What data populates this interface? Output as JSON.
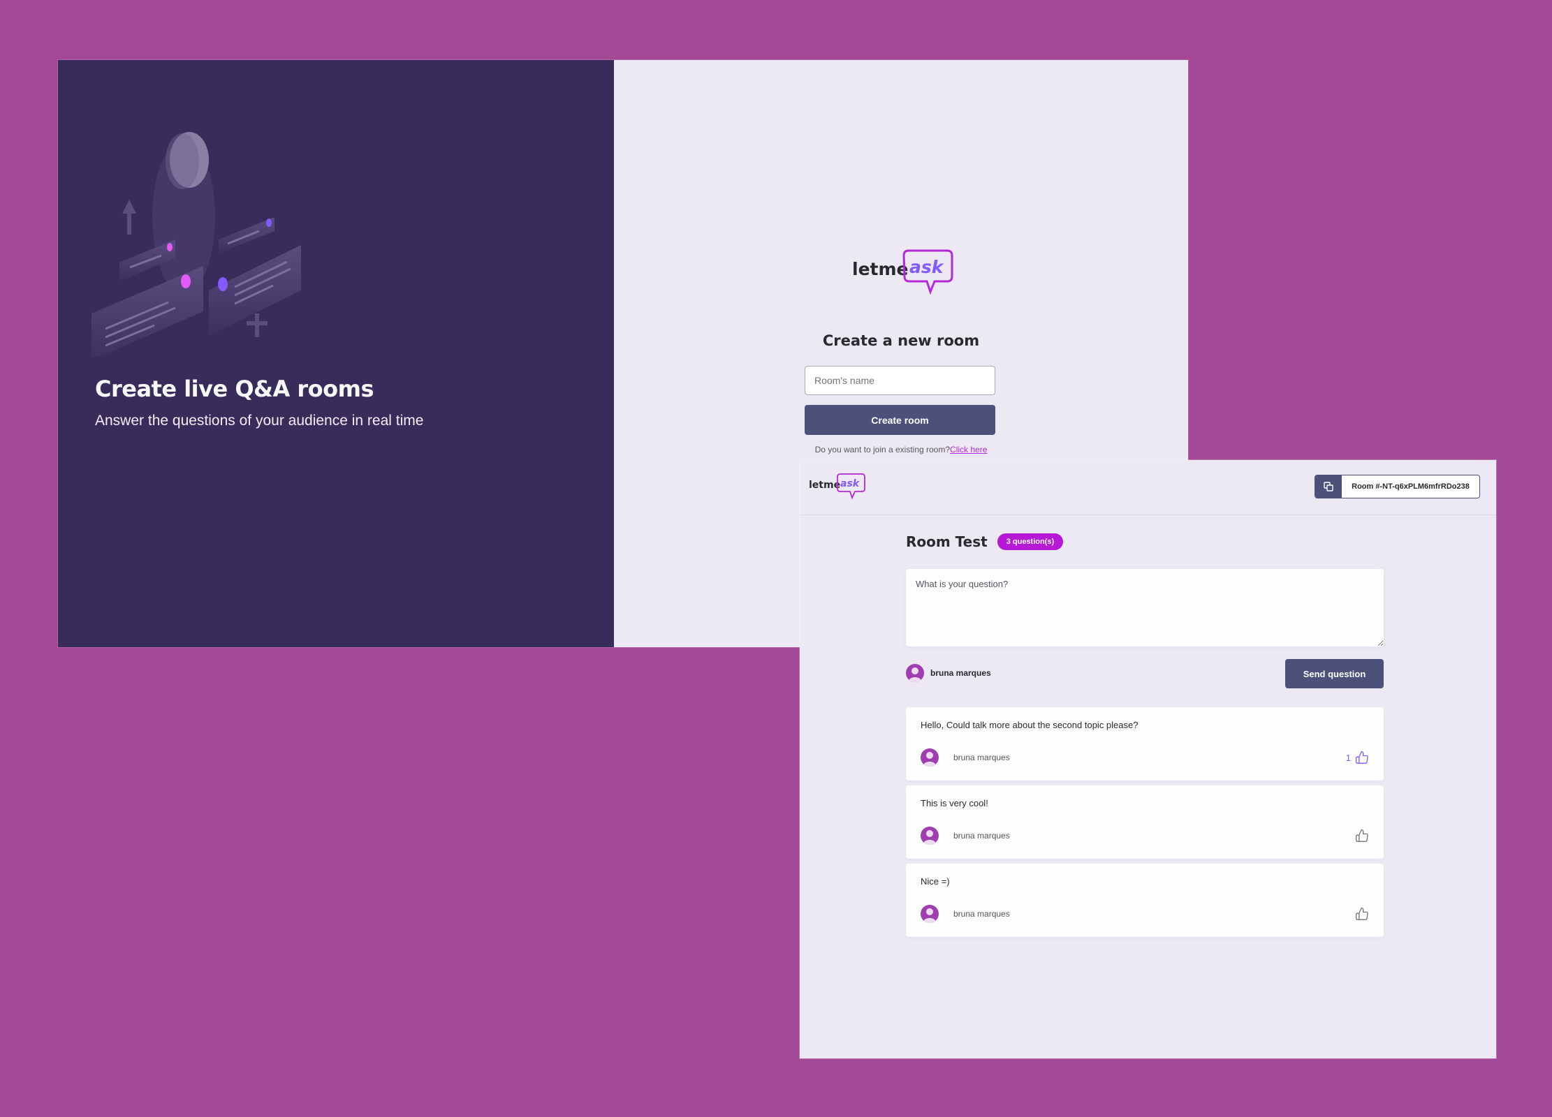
{
  "create_page": {
    "hero_title": "Create live Q&A rooms",
    "hero_subtitle": "Answer the questions of your audience in real time",
    "logo": {
      "part1": "letme",
      "part2": "ask"
    },
    "form_title": "Create a new room",
    "room_name_placeholder": "Room's name",
    "create_button": "Create room",
    "join_prompt": "Do you want to join a existing room?",
    "join_link": "Click here"
  },
  "room_page": {
    "logo": {
      "part1": "letme",
      "part2": "ask"
    },
    "room_code": "Room #-NT-q6xPLM6mfrRDo238",
    "title": "Room Test",
    "question_count": "3 question(s)",
    "question_placeholder": "What is your question?",
    "user_name": "bruna marques",
    "send_button": "Send question",
    "questions": [
      {
        "text": "Hello, Could talk more about the second topic please?",
        "author": "bruna marques",
        "likes": "1"
      },
      {
        "text": "This is very cool!",
        "author": "bruna marques",
        "likes": ""
      },
      {
        "text": "Nice =)",
        "author": "bruna marques",
        "likes": ""
      }
    ]
  },
  "colors": {
    "background": "#a44996",
    "dark_panel": "#382c5a",
    "light_panel": "#ece9f4",
    "button": "#4b5178",
    "accent_purple": "#835afd",
    "accent_pink": "#e559f9",
    "badge": "#b717d6"
  }
}
